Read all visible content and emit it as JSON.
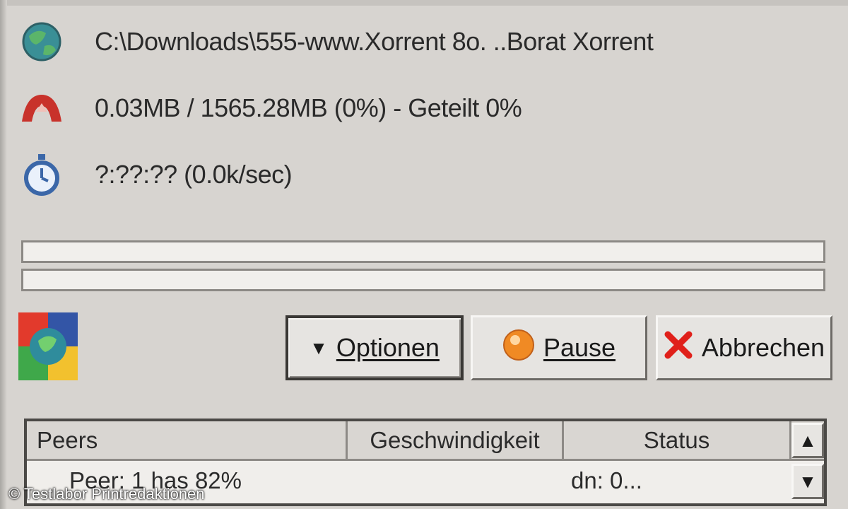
{
  "info": {
    "path": "C:\\Downloads\\555-www.Xorrent 8o. ..Borat Xorrent",
    "size": "0.03MB / 1565.28MB (0%) - Geteilt 0%",
    "time": "?:??:?? (0.0k/sec)"
  },
  "progress": {
    "download_fraction": 0.0,
    "upload_fraction": 0.0
  },
  "buttons": {
    "options_label": "Optionen",
    "pause_label": "Pause",
    "cancel_label": "Abbrechen"
  },
  "peers_list": {
    "columns": [
      "Peers",
      "Geschwindigkeit",
      "Status"
    ],
    "rows": [
      {
        "peers": "Peer: 1 has 82%",
        "speed": "",
        "status": "dn: 0..."
      }
    ]
  },
  "copyright": "© Testlabor Printredaktionen",
  "icons": {
    "path": "globe-icon",
    "size": "transfer-icon",
    "time": "stopwatch-icon",
    "logo": "app-logo-icon",
    "options": "dropdown-arrow-icon",
    "pause": "pause-icon",
    "cancel": "cancel-icon",
    "scroll_up": "scroll-up-icon",
    "scroll_down": "scroll-down-icon"
  }
}
